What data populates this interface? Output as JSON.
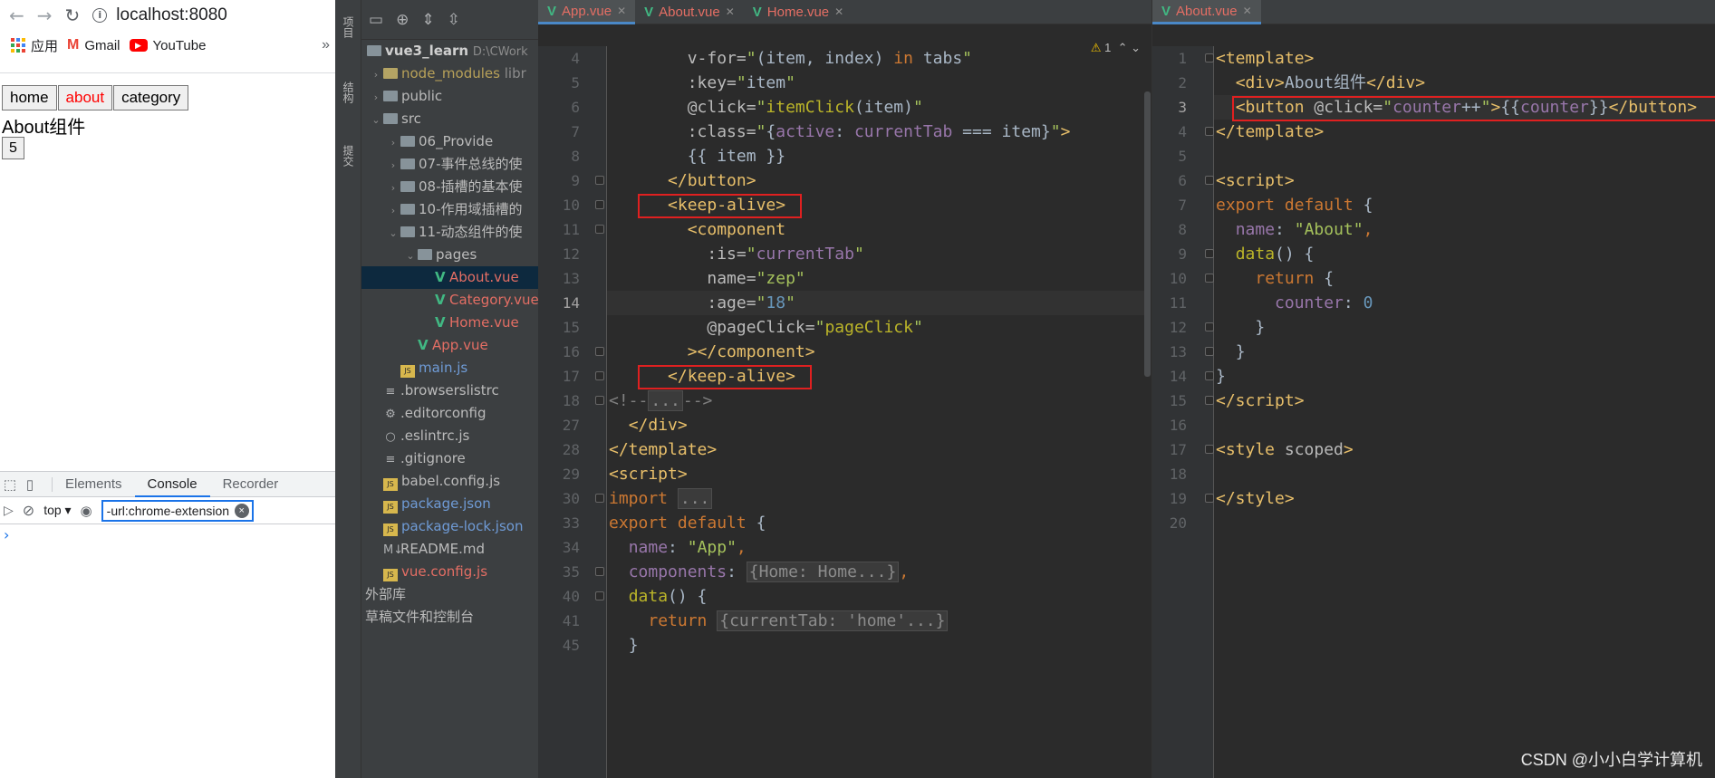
{
  "browser": {
    "url": "localhost:8080",
    "bookmarks": [
      {
        "label": "应用",
        "icon": "apps-grid-icon"
      },
      {
        "label": "Gmail",
        "icon": "gmail-icon"
      },
      {
        "label": "YouTube",
        "icon": "youtube-icon"
      }
    ],
    "bookmarks_more": "»",
    "page": {
      "tabs": [
        "home",
        "about",
        "category"
      ],
      "active_tab": "about",
      "component_text": "About组件",
      "counter": "5"
    },
    "devtools": {
      "tabs": [
        "Elements",
        "Console",
        "Recorder"
      ],
      "active_tab": "Console",
      "context": "top ▾",
      "filter_value": "-url:chrome-extension",
      "prompt": "›"
    }
  },
  "ide": {
    "side_labels": [
      "项目",
      "结构",
      "提交"
    ],
    "project_root": "vue3_learn",
    "project_path": "D:\\CWork",
    "tree": [
      {
        "label": "node_modules",
        "suffix": "libr",
        "indent": 0,
        "kind": "folder-yellow",
        "style": "ignored",
        "arrow": "›"
      },
      {
        "label": "public",
        "indent": 0,
        "kind": "folder",
        "arrow": "›"
      },
      {
        "label": "src",
        "indent": 0,
        "kind": "folder",
        "arrow": "⌄"
      },
      {
        "label": "06_Provide",
        "indent": 1,
        "kind": "folder",
        "arrow": "›"
      },
      {
        "label": "07-事件总线的使",
        "indent": 1,
        "kind": "folder",
        "arrow": "›"
      },
      {
        "label": "08-插槽的基本使",
        "indent": 1,
        "kind": "folder",
        "arrow": "›"
      },
      {
        "label": "10-作用域插槽的",
        "indent": 1,
        "kind": "folder",
        "arrow": "›"
      },
      {
        "label": "11-动态组件的使",
        "indent": 1,
        "kind": "folder",
        "arrow": "⌄"
      },
      {
        "label": "pages",
        "indent": 2,
        "kind": "folder",
        "arrow": "⌄"
      },
      {
        "label": "About.vue",
        "indent": 3,
        "kind": "vue",
        "style": "red",
        "selected": true
      },
      {
        "label": "Category.vue",
        "indent": 3,
        "kind": "vue",
        "style": "red"
      },
      {
        "label": "Home.vue",
        "indent": 3,
        "kind": "vue",
        "style": "red"
      },
      {
        "label": "App.vue",
        "indent": 2,
        "kind": "vue",
        "style": "red"
      },
      {
        "label": "main.js",
        "indent": 1,
        "kind": "js",
        "style": "blue"
      },
      {
        "label": ".browserslistrc",
        "indent": 0,
        "kind": "file",
        "icon": "≡"
      },
      {
        "label": ".editorconfig",
        "indent": 0,
        "kind": "file",
        "icon": "⚙"
      },
      {
        "label": ".eslintrc.js",
        "indent": 0,
        "kind": "file",
        "icon": "○"
      },
      {
        "label": ".gitignore",
        "indent": 0,
        "kind": "file",
        "icon": "≡"
      },
      {
        "label": "babel.config.js",
        "indent": 0,
        "kind": "js"
      },
      {
        "label": "package.json",
        "indent": 0,
        "kind": "js",
        "style": "blue"
      },
      {
        "label": "package-lock.json",
        "indent": 0,
        "kind": "js",
        "style": "blue"
      },
      {
        "label": "README.md",
        "indent": 0,
        "kind": "file",
        "icon": "M↓"
      },
      {
        "label": "vue.config.js",
        "indent": 0,
        "kind": "js",
        "style": "red"
      },
      {
        "label": "外部库",
        "indent": -1,
        "kind": "none"
      },
      {
        "label": "草稿文件和控制台",
        "indent": -1,
        "kind": "none"
      }
    ],
    "left_editor": {
      "tabs": [
        {
          "label": "App.vue",
          "active": true
        },
        {
          "label": "About.vue",
          "active": false
        },
        {
          "label": "Home.vue",
          "active": false
        }
      ],
      "warning": "1",
      "current_line": "14",
      "lines": [
        {
          "n": "4",
          "html": "        <span class=\"attr\">v-for=</span><span class=\"str\">\"</span><span class=\"txt\">(item, index) </span><span class=\"kw\">in</span><span class=\"txt\"> tabs</span><span class=\"str\">\"</span>"
        },
        {
          "n": "5",
          "html": "        <span class=\"attr\">:key=</span><span class=\"str\">\"</span><span class=\"txt\">item</span><span class=\"str\">\"</span>"
        },
        {
          "n": "6",
          "html": "        <span class=\"attr\">@click=</span><span class=\"str\">\"</span><span class=\"ann\">itemClick</span><span class=\"txt\">(item)</span><span class=\"str\">\"</span>"
        },
        {
          "n": "7",
          "html": "        <span class=\"attr\">:class=</span><span class=\"str\">\"</span><span class=\"txt\">{</span><span class=\"prop\">active</span><span class=\"txt\">: </span><span class=\"prop\">currentTab</span><span class=\"txt\"> === item}</span><span class=\"str\">\"</span><span class=\"tag\">&gt;</span>"
        },
        {
          "n": "8",
          "html": "        <span class=\"txt\">{{ item }}</span>"
        },
        {
          "n": "9",
          "html": "      <span class=\"tag\">&lt;/button&gt;</span>"
        },
        {
          "n": "10",
          "html": "      <span class=\"tag\">&lt;keep-alive&gt;</span>"
        },
        {
          "n": "11",
          "html": "        <span class=\"tag\">&lt;component</span>"
        },
        {
          "n": "12",
          "html": "          <span class=\"attr\">:is=</span><span class=\"str\">\"</span><span class=\"prop\">currentTab</span><span class=\"str\">\"</span>"
        },
        {
          "n": "13",
          "html": "          <span class=\"attr\">name=</span><span class=\"str\">\"zep\"</span>"
        },
        {
          "n": "14",
          "html": "          <span class=\"attr\">:age=</span><span class=\"str\">\"</span><span class=\"num\">18</span><span class=\"str\">\"</span>"
        },
        {
          "n": "15",
          "html": "          <span class=\"attr\">@pageClick=</span><span class=\"str\">\"</span><span class=\"ann\">pageClick</span><span class=\"str\">\"</span>"
        },
        {
          "n": "16",
          "html": "        <span class=\"tag\">&gt;&lt;/component&gt;</span>"
        },
        {
          "n": "17",
          "html": "      <span class=\"tag\">&lt;/keep-alive&gt;</span>"
        },
        {
          "n": "18",
          "html": "<span class=\"cmt\">&lt;!--<span class=\"fold-box\">...</span>--&gt;</span>"
        },
        {
          "n": "27",
          "html": "  <span class=\"tag\">&lt;/div&gt;</span>"
        },
        {
          "n": "28",
          "html": "<span class=\"tag\">&lt;/template&gt;</span>"
        },
        {
          "n": "29",
          "html": "<span class=\"tag\">&lt;script&gt;</span>"
        },
        {
          "n": "30",
          "html": "<span class=\"kw\">import</span> <span class=\"fold-box\">...</span>"
        },
        {
          "n": "33",
          "html": "<span class=\"kw\">export default</span> <span class=\"txt\">{</span>"
        },
        {
          "n": "34",
          "html": "  <span class=\"prop\">name</span><span class=\"txt\">: </span><span class=\"str\">\"App\"</span><span class=\"kw\">,</span>"
        },
        {
          "n": "35",
          "html": "  <span class=\"prop\">components</span><span class=\"txt\">: </span><span class=\"fold-box\">{Home: Home...}</span><span class=\"kw\">,</span>"
        },
        {
          "n": "40",
          "html": "  <span class=\"ann\">data</span><span class=\"txt\">() {</span>"
        },
        {
          "n": "41",
          "html": "    <span class=\"kw\">return</span> <span class=\"fold-box\">{currentTab: 'home'...}</span>"
        },
        {
          "n": "45",
          "html": "  <span class=\"txt\">}</span>"
        }
      ]
    },
    "right_editor": {
      "tabs": [
        {
          "label": "About.vue",
          "active": true
        }
      ],
      "current_line": "3",
      "lines": [
        {
          "n": "1",
          "html": "<span class=\"tag\">&lt;template&gt;</span>"
        },
        {
          "n": "2",
          "html": "  <span class=\"tag\">&lt;div&gt;</span><span class=\"txt\">About组件</span><span class=\"tag\">&lt;/div&gt;</span>"
        },
        {
          "n": "3",
          "html": "  <span class=\"tag\">&lt;button </span><span class=\"attr\">@click=</span><span class=\"str\">\"</span><span class=\"prop\">counter</span><span class=\"txt\">++</span><span class=\"str\">\"</span><span class=\"tag\">&gt;</span><span class=\"txt\">{{</span><span class=\"prop\">counter</span><span class=\"txt\">}}</span><span class=\"tag\">&lt;/button&gt;</span>"
        },
        {
          "n": "4",
          "html": "<span class=\"tag\">&lt;/template&gt;</span>"
        },
        {
          "n": "5",
          "html": ""
        },
        {
          "n": "6",
          "html": "<span class=\"tag\">&lt;script&gt;</span>"
        },
        {
          "n": "7",
          "html": "<span class=\"kw\">export default</span> <span class=\"txt\">{</span>"
        },
        {
          "n": "8",
          "html": "  <span class=\"prop\">name</span><span class=\"txt\">: </span><span class=\"str\">\"About\"</span><span class=\"kw\">,</span>"
        },
        {
          "n": "9",
          "html": "  <span class=\"ann\">data</span><span class=\"txt\">() {</span>"
        },
        {
          "n": "10",
          "html": "    <span class=\"kw\">return</span> <span class=\"txt\">{</span>"
        },
        {
          "n": "11",
          "html": "      <span class=\"prop\">counter</span><span class=\"txt\">: </span><span class=\"num\">0</span>"
        },
        {
          "n": "12",
          "html": "    <span class=\"txt\">}</span>"
        },
        {
          "n": "13",
          "html": "  <span class=\"txt\">}</span>"
        },
        {
          "n": "14",
          "html": "<span class=\"txt\">}</span>"
        },
        {
          "n": "15",
          "html": "<span class=\"tag\">&lt;/script&gt;</span>"
        },
        {
          "n": "16",
          "html": ""
        },
        {
          "n": "17",
          "html": "<span class=\"tag\">&lt;style </span><span class=\"attr\">scoped</span><span class=\"tag\">&gt;</span>"
        },
        {
          "n": "18",
          "html": ""
        },
        {
          "n": "19",
          "html": "<span class=\"tag\">&lt;/style&gt;</span>"
        },
        {
          "n": "20",
          "html": ""
        }
      ]
    },
    "watermark": "CSDN @小小白学计算机"
  }
}
